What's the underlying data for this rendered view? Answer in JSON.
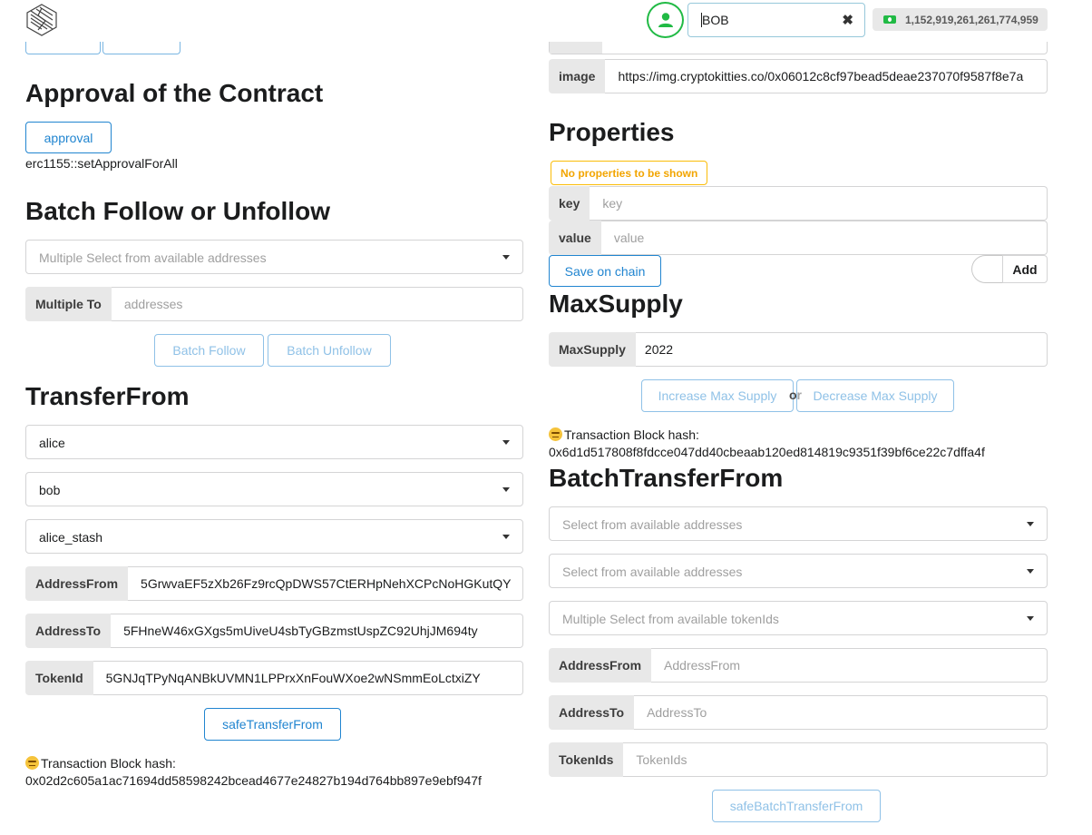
{
  "header": {
    "account": "BOB",
    "balance": "1,152,919,261,261,774,959"
  },
  "approval": {
    "title": "Approval of the Contract",
    "button": "approval",
    "method": "erc1155::setApprovalForAll"
  },
  "batch_follow": {
    "title": "Batch Follow or Unfollow",
    "select_placeholder": "Multiple Select from available addresses",
    "multiple_to_label": "Multiple To",
    "multiple_to_placeholder": "addresses",
    "follow_button": "Batch Follow",
    "unfollow_button": "Batch Unfollow"
  },
  "transfer_from": {
    "title": "TransferFrom",
    "select_from": "alice",
    "select_to": "bob",
    "select_token": "alice_stash",
    "address_from_label": "AddressFrom",
    "address_from_value": "5GrwvaEF5zXb26Fz9rcQpDWS57CtERHpNehXCPcNoHGKutQY",
    "address_to_label": "AddressTo",
    "address_to_value": "5FHneW46xGXgs5mUiveU4sbTyGBzmstUspZC92UhjJM694ty",
    "token_id_label": "TokenId",
    "token_id_value": "5GNJqTPyNqANBkUVMN1LPPrxXnFouWXoe2wNSmmEoLctxiZY",
    "button": "safeTransferFrom",
    "hash_label": "Transaction Block hash:",
    "hash_value": "0x02d2c605a1ac71694dd58598242bcead4677e24827b194d764bb897e9ebf947f"
  },
  "image_field": {
    "label": "image",
    "value": "https://img.cryptokitties.co/0x06012c8cf97bead5deae237070f9587f8e7a"
  },
  "properties": {
    "title": "Properties",
    "empty_badge": "No properties to be shown",
    "key_label": "key",
    "key_placeholder": "key",
    "value_label": "value",
    "value_placeholder": "value",
    "save_button": "Save on chain",
    "add_label": "Add"
  },
  "max_supply": {
    "title": "MaxSupply",
    "label": "MaxSupply",
    "value": "2022",
    "increase_button": "Increase Max Supply",
    "or_text": "or",
    "decrease_button": "Decrease Max Supply",
    "hash_label": "Transaction Block hash:",
    "hash_value": "0x6d1d517808f8fdcce047dd40cbeaab120ed814819c9351f39bf6ce22c7dffa4f"
  },
  "batch_transfer": {
    "title": "BatchTransferFrom",
    "select_from_placeholder": "Select from available addresses",
    "select_to_placeholder": "Select from available addresses",
    "select_tokens_placeholder": "Multiple Select from available tokenIds",
    "address_from_label": "AddressFrom",
    "address_from_placeholder": "AddressFrom",
    "address_to_label": "AddressTo",
    "address_to_placeholder": "AddressTo",
    "token_ids_label": "TokenIds",
    "token_ids_placeholder": "TokenIds",
    "button": "safeBatchTransferFrom"
  }
}
